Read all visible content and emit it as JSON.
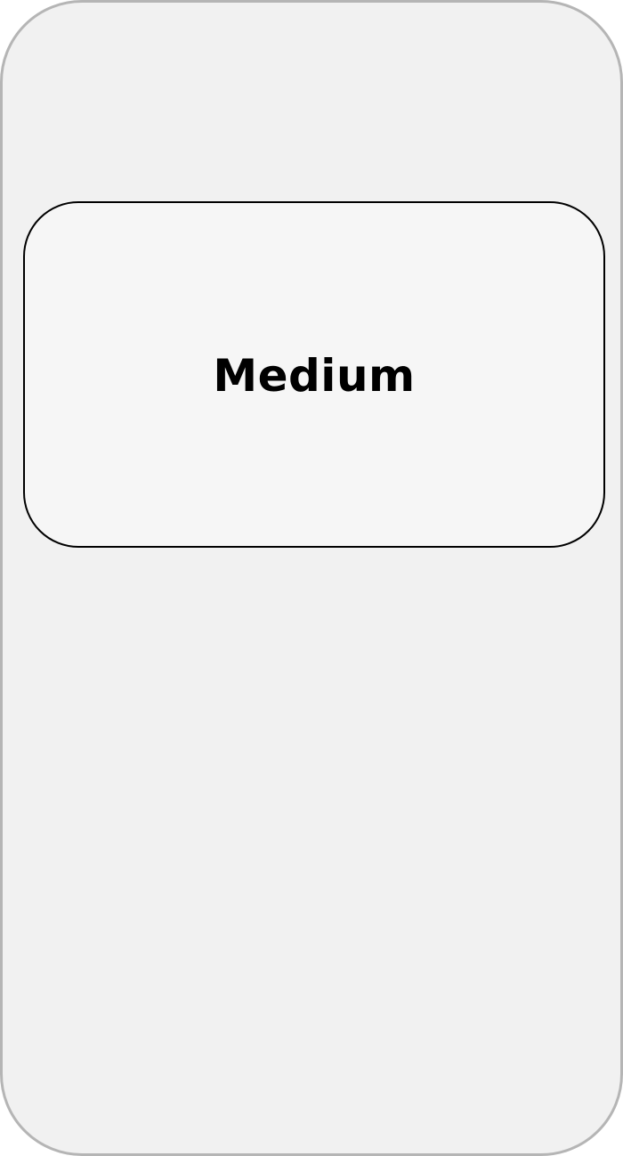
{
  "screen": {
    "background_color": "#f1f1f1",
    "border_color": "#b5b5b5"
  },
  "card": {
    "label": "Medium",
    "background_color": "#f6f6f6",
    "border_color": "#000000"
  }
}
